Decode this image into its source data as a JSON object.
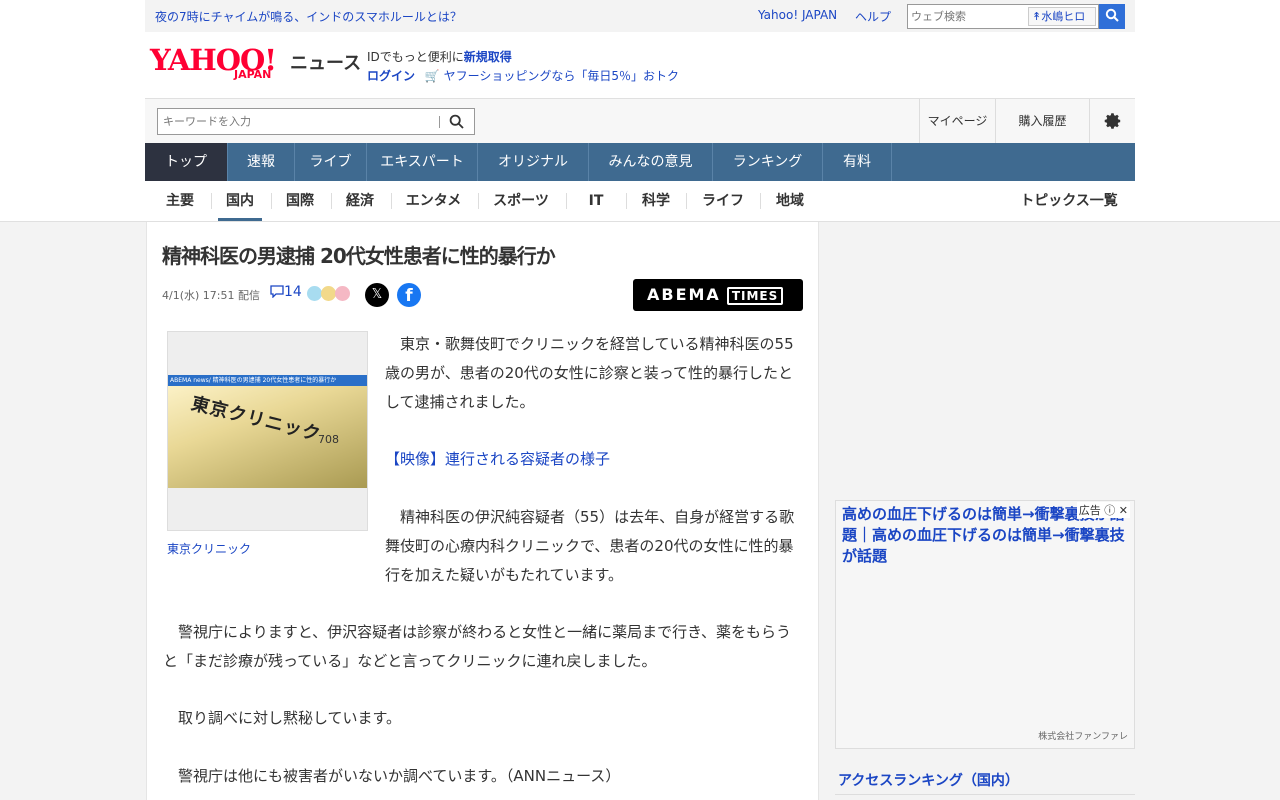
{
  "topbar": {
    "promo": "夜の7時にチャイムが鳴る、インドのスマホルールとは？",
    "yahoo_japan": "Yahoo! JAPAN",
    "help": "ヘルプ",
    "web_search_placeholder": "ウェブ検索",
    "user_name": "水嶋ヒロ"
  },
  "logo": {
    "main": "YAHOO!",
    "sub": "JAPAN",
    "service": "ニュース"
  },
  "login_box": {
    "line1_prefix": "IDでもっと便利に",
    "line1_link": "新規取得",
    "login": "ログイン",
    "shop_promo": "ヤフーショッピングなら「毎日5％」おトク"
  },
  "search": {
    "placeholder": "キーワードを入力"
  },
  "header_links": {
    "mypage": "マイページ",
    "purchase": "購入履歴"
  },
  "main_nav": [
    {
      "label": "トップ",
      "active": true
    },
    {
      "label": "速報"
    },
    {
      "label": "ライブ"
    },
    {
      "label": "エキスパート"
    },
    {
      "label": "オリジナル"
    },
    {
      "label": "みんなの意見"
    },
    {
      "label": "ランキング"
    },
    {
      "label": "有料"
    }
  ],
  "sub_nav": [
    {
      "label": "主要"
    },
    {
      "label": "国内",
      "active": true
    },
    {
      "label": "国際"
    },
    {
      "label": "経済"
    },
    {
      "label": "エンタメ"
    },
    {
      "label": "スポーツ"
    },
    {
      "label": "IT"
    },
    {
      "label": "科学"
    },
    {
      "label": "ライフ"
    },
    {
      "label": "地域"
    }
  ],
  "topics_link": "トピックス一覧",
  "article": {
    "headline": "精神科医の男逮捕 20代女性患者に性的暴行か",
    "date": "4/1(水) 17:51 配信",
    "comment_count": "14",
    "source_logo": "ABEMA",
    "source_logo_sub": "TIMES",
    "photo_caption": "東京クリニック",
    "photo_strip_text": "ABEMA news/ 精神科医の男逮捕 20代女性患者に性的暴行か",
    "photo_sign_text": "東京クリニック",
    "photo_room_number": "708",
    "p1": "東京・歌舞伎町でクリニックを経営している精神科医の55歳の男が、患者の20代の女性に診察と装って性的暴行したとして逮捕されました。",
    "video_link": "【映像】連行される容疑者の様子",
    "p2": "精神科医の伊沢純容疑者（55）は去年、自身が経営する歌舞伎町の心療内科クリニックで、患者の20代の女性に性的暴行を加えた疑いがもたれています。",
    "p3": "警視庁によりますと、伊沢容疑者は診察が終わると女性と一緒に薬局まで行き、薬をもらうと「まだ診療が残っている」などと言ってクリニックに連れ戻しました。",
    "p4": "取り調べに対し黙秘しています。",
    "p5": "警視庁は他にも被害者がいないか調べています。（ANNニュース）"
  },
  "ad": {
    "title": "高めの血圧下げるのは簡単→衝撃裏技が話題｜高めの血圧下げるのは簡単→衝撃裏技が話題",
    "label": "広告",
    "advertiser": "株式会社ファンファレ"
  },
  "ranking": {
    "title": "アクセスランキング（国内）"
  },
  "colors": {
    "accent": "#1b46c4",
    "nav_bg": "#3f6a90",
    "nav_active": "#2d3240",
    "logo_red": "#ff0033",
    "search_btn": "#2f6fd8"
  },
  "icons": [
    "search-icon",
    "settings-gear-icon",
    "comment-icon",
    "x-icon",
    "facebook-icon",
    "cart-icon",
    "close-icon",
    "info-icon"
  ]
}
